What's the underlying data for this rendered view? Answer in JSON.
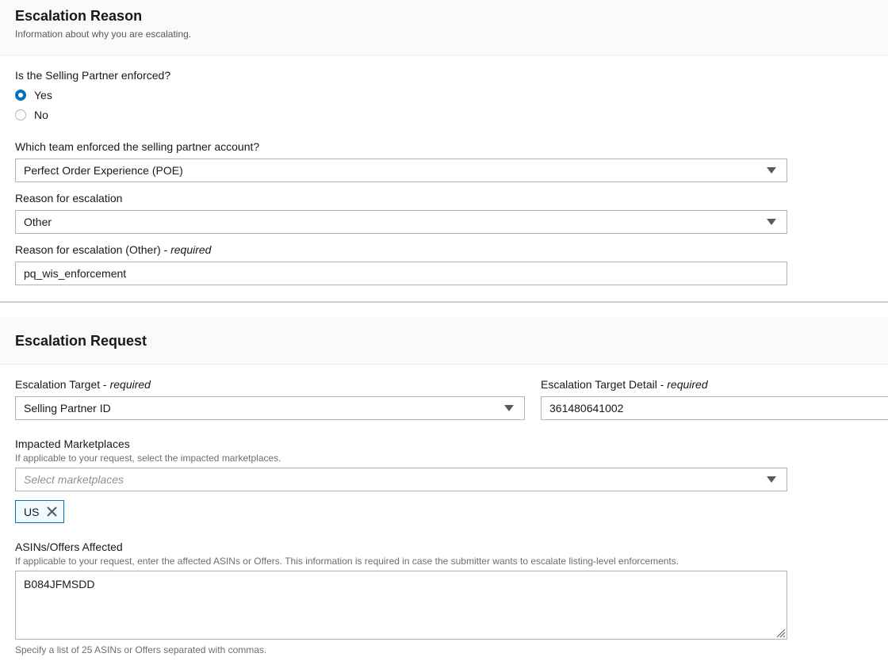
{
  "reason_section": {
    "title": "Escalation Reason",
    "description": "Information about why you are escalating.",
    "enforced_question": "Is the Selling Partner enforced?",
    "enforced_options": [
      {
        "label": "Yes",
        "checked": true
      },
      {
        "label": "No",
        "checked": false
      }
    ],
    "team_label": "Which team enforced the selling partner account?",
    "team_value": "Perfect Order Experience (POE)",
    "reason_label": "Reason for escalation",
    "reason_value": "Other",
    "reason_other_label": "Reason for escalation (Other) - ",
    "reason_other_required": "required",
    "reason_other_value": "pq_wis_enforcement"
  },
  "request_section": {
    "title": "Escalation Request",
    "target_label": "Escalation Target - ",
    "target_required": "required",
    "target_value": "Selling Partner ID",
    "target_detail_label": "Escalation Target Detail - ",
    "target_detail_required": "required",
    "target_detail_value": "361480641002",
    "marketplaces_label": "Impacted Marketplaces",
    "marketplaces_hint": "If applicable to your request, select the impacted marketplaces.",
    "marketplaces_placeholder": "Select marketplaces",
    "marketplace_tokens": [
      "US"
    ],
    "asins_label": "ASINs/Offers Affected",
    "asins_hint": "If applicable to your request, enter the affected ASINs or Offers. This information is required in case the submitter wants to escalate listing-level enforcements.",
    "asins_value": "B084JFMSDD",
    "asins_constraint": "Specify a list of 25 ASINs or Offers separated with commas."
  },
  "colors": {
    "accent": "#0073bb",
    "border": "#aab7b8",
    "header_bg": "#fafafa",
    "text": "#16191f",
    "hint_text": "#687078"
  },
  "icons": [
    "dropdown-caret-icon",
    "close-icon",
    "resize-handle-icon"
  ]
}
